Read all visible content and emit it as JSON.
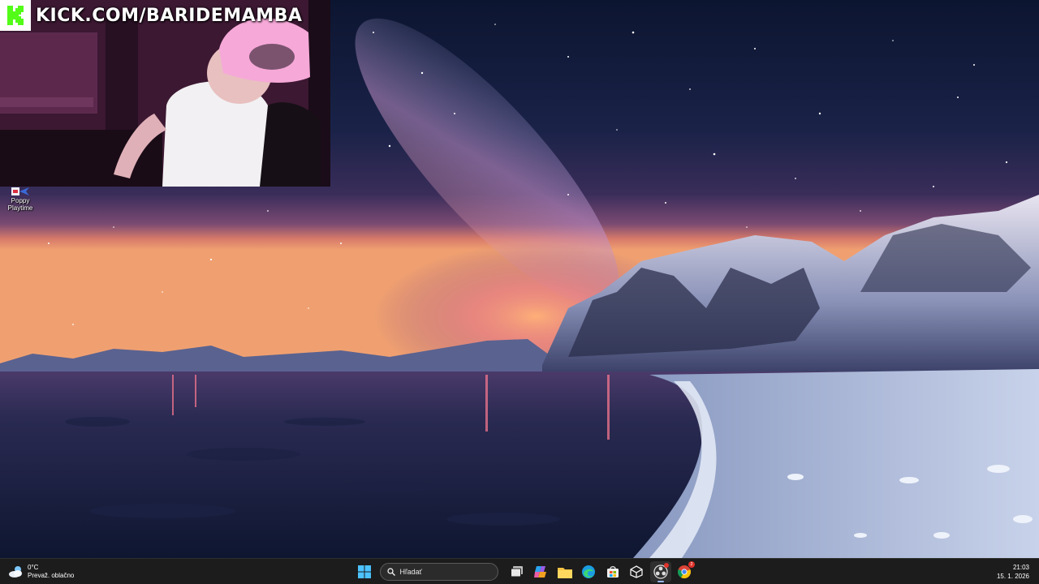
{
  "stream_overlay": {
    "url": "KICK.COM/BARIDEMAMBA",
    "brand_color": "#53fc18"
  },
  "desktop": {
    "icons": [
      {
        "label_line1": "Poppy",
        "label_line2": "Playtime",
        "icon": "poppy-playtime-icon"
      }
    ]
  },
  "taskbar": {
    "weather": {
      "temperature": "0°C",
      "condition": "Prevaž. oblačno",
      "icon": "weather-partly-cloudy-icon"
    },
    "search": {
      "placeholder": "Hľadať"
    },
    "apps": [
      {
        "icon": "windows-start-icon"
      },
      {
        "icon": "task-view-icon"
      },
      {
        "icon": "copilot-icon"
      },
      {
        "icon": "file-explorer-icon"
      },
      {
        "icon": "edge-browser-icon"
      },
      {
        "icon": "microsoft-store-icon"
      },
      {
        "icon": "3d-box-app-icon"
      },
      {
        "icon": "obs-studio-icon",
        "active": true
      },
      {
        "icon": "chrome-icon",
        "badge": "2"
      }
    ],
    "clock": {
      "time": "21:03",
      "date": "15. 1. 2026"
    }
  }
}
